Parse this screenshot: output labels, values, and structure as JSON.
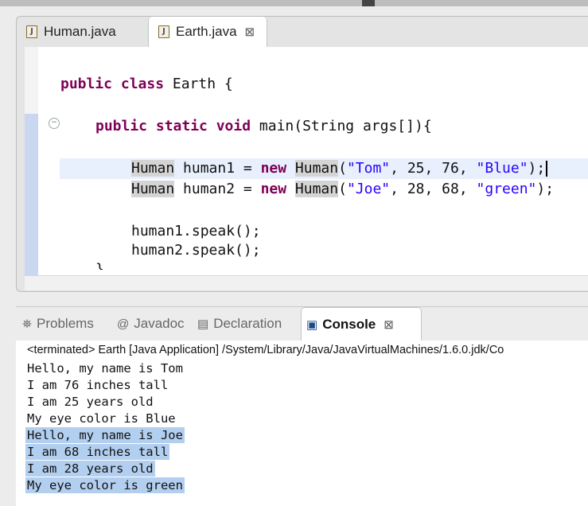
{
  "editor": {
    "tabs": [
      {
        "label": "Human.java",
        "icon": "java-file-icon"
      },
      {
        "label": "Earth.java",
        "icon": "java-file-icon",
        "active": true
      }
    ],
    "close_glyph": "⊠",
    "code": {
      "class_kw": "public class",
      "class_rest": " Earth {",
      "main_kw": "public static void",
      "main_rest": " main(String args[]){",
      "l1_type": "Human",
      "l1_mid": " human1 = ",
      "l1_new": "new",
      "l1_cls": "Human",
      "l1_open": "(",
      "l1_s1": "\"Tom\"",
      "l1_nums": ", 25, 76, ",
      "l1_s2": "\"Blue\"",
      "l1_end": ");",
      "l2_type": "Human",
      "l2_mid": " human2 = ",
      "l2_new": "new",
      "l2_cls": "Human",
      "l2_open": "(",
      "l2_s1": "\"Joe\"",
      "l2_nums": ", 28, 68, ",
      "l2_s2": "\"green\"",
      "l2_end": ");",
      "speak1": "human1.speak();",
      "speak2": "human2.speak();"
    }
  },
  "console": {
    "tabs": [
      {
        "label": "Problems",
        "icon": "problems-icon"
      },
      {
        "label": "Javadoc",
        "icon": "at-icon"
      },
      {
        "label": "Declaration",
        "icon": "declaration-icon"
      },
      {
        "label": "Console",
        "icon": "console-icon",
        "active": true
      }
    ],
    "terminated": "<terminated> Earth [Java Application] /System/Library/Java/JavaVirtualMachines/1.6.0.jdk/Co",
    "output": [
      "Hello, my name is Tom",
      "I am 76 inches tall",
      "I am 25 years old",
      "My eye color is Blue",
      "Hello, my name is Joe",
      "I am 68 inches tall",
      "I am 28 years old",
      "My eye color is green"
    ]
  }
}
